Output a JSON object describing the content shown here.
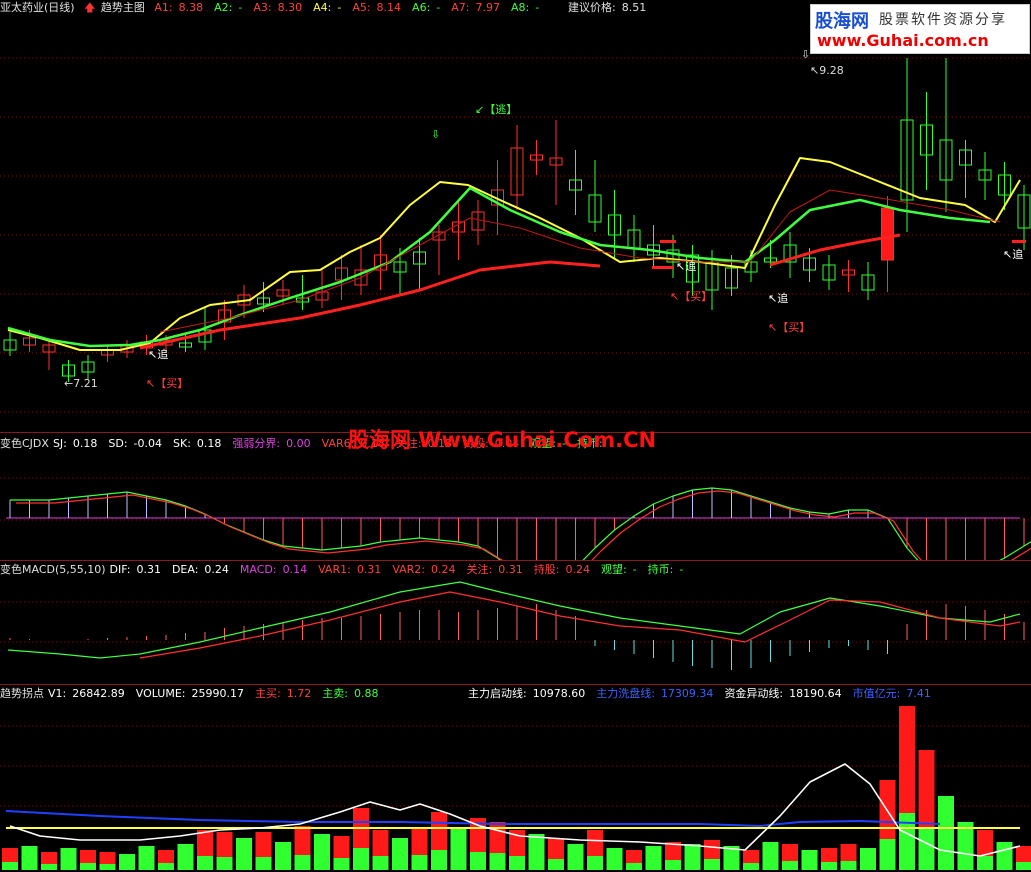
{
  "main": {
    "stock_name": "亚太药业(日线)",
    "indicator": "趋势主图",
    "a_values": [
      {
        "label": "A1:",
        "value": "8.38",
        "color": "#ff4040"
      },
      {
        "label": "A2:",
        "value": "-",
        "color": "#40ff40"
      },
      {
        "label": "A3:",
        "value": "8.30",
        "color": "#ff4040"
      },
      {
        "label": "A4:",
        "value": "-",
        "color": "#ffff40"
      },
      {
        "label": "A5:",
        "value": "8.14",
        "color": "#ff4040"
      },
      {
        "label": "A6:",
        "value": "-",
        "color": "#40ff40"
      },
      {
        "label": "A7:",
        "value": "7.97",
        "color": "#ff4040"
      },
      {
        "label": "A8:",
        "value": "-",
        "color": "#40ff40"
      }
    ],
    "suggest_label": "建议价格:",
    "suggest_value": "8.51",
    "high_label": "9.28",
    "low_label": "7.21",
    "tags": {
      "zhui": "追",
      "mai": "【买】",
      "tao": "【逃】"
    }
  },
  "logo": {
    "brand": "股海网",
    "sub": "股票软件资源分享",
    "url": "www.Guhai.com.cn"
  },
  "watermark": "股海网 Www.Guhai.Com.CN",
  "cjdx": {
    "title": "变色CJDX",
    "fields": [
      {
        "label": "SJ:",
        "value": "0.18",
        "color": "#ffffff"
      },
      {
        "label": "SD:",
        "value": "-0.04",
        "color": "#ffffff"
      },
      {
        "label": "SK:",
        "value": "0.18",
        "color": "#ffffff"
      },
      {
        "label": "强弱分界:",
        "value": "0.00",
        "color": "#e040e0"
      },
      {
        "label": "VAR6:",
        "value": "0.18",
        "color": "#ff4040"
      },
      {
        "label": "关注:",
        "value": "0.18",
        "color": "#ff4040"
      },
      {
        "label": "持股:",
        "value": "0.04",
        "color": "#ff4040"
      },
      {
        "label": "观望:",
        "value": "-",
        "color": "#40ff40"
      },
      {
        "label": "持币:",
        "value": "",
        "color": "#40ff40"
      }
    ]
  },
  "macd": {
    "title": "变色MACD(5,55,10)",
    "fields": [
      {
        "label": "DIF:",
        "value": "0.31",
        "color": "#ffffff"
      },
      {
        "label": "DEA:",
        "value": "0.24",
        "color": "#ffffff"
      },
      {
        "label": "MACD:",
        "value": "0.14",
        "color": "#e040e0"
      },
      {
        "label": "VAR1:",
        "value": "0.31",
        "color": "#ff4040"
      },
      {
        "label": "VAR2:",
        "value": "0.24",
        "color": "#ff4040"
      },
      {
        "label": "关注:",
        "value": "0.31",
        "color": "#ff4040"
      },
      {
        "label": "持股:",
        "value": "0.24",
        "color": "#ff4040"
      },
      {
        "label": "观望:",
        "value": "-",
        "color": "#40ff40"
      },
      {
        "label": "持币:",
        "value": "-",
        "color": "#40ff40"
      }
    ]
  },
  "volume": {
    "title": "趋势拐点",
    "fields": [
      {
        "label": "V1:",
        "value": "26842.89",
        "color": "#ffffff"
      },
      {
        "label": "VOLUME:",
        "value": "25990.17",
        "color": "#ffffff"
      },
      {
        "label": "主买:",
        "value": "1.72",
        "color": "#ff4040"
      },
      {
        "label": "主卖:",
        "value": "0.88",
        "color": "#40ff40"
      }
    ],
    "fields_right": [
      {
        "label": "主力启动线:",
        "value": "10978.60",
        "color": "#ffffff"
      },
      {
        "label": "主力洗盘线:",
        "value": "17309.34",
        "color": "#4060ff"
      },
      {
        "label": "资金异动线:",
        "value": "18190.64",
        "color": "#ffffff"
      },
      {
        "label": "市值亿元:",
        "value": "7.41",
        "color": "#4060ff"
      }
    ]
  }
}
